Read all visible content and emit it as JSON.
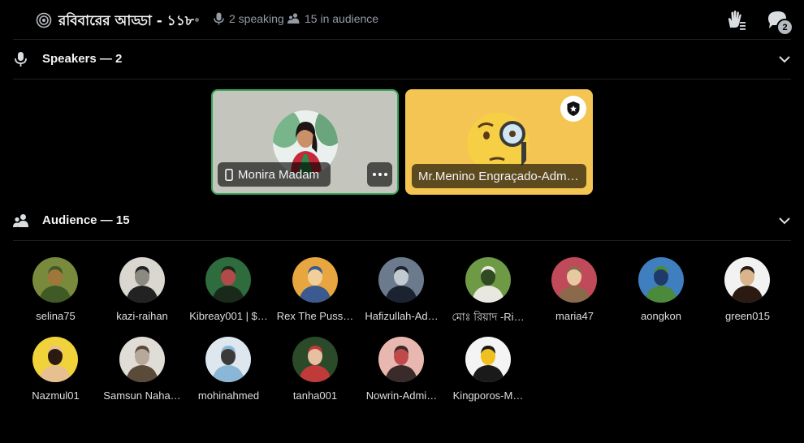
{
  "header": {
    "title": "রবিবারের আড্ডা - ১১৮",
    "speaking": "2 speaking",
    "audience": "15 in audience",
    "chat_badge": "2",
    "icons": [
      "stage-icon",
      "microphone-icon",
      "audience-icon",
      "raise-hand-icon",
      "chat-icon"
    ]
  },
  "speakers_section": {
    "label": "Speakers — 2"
  },
  "speakers": [
    {
      "name": "Monira Madam",
      "device": "mobile-icon",
      "speaking": true,
      "bg": "#c4c6bd"
    },
    {
      "name": "Mr.Menino Engraçado-Adm…",
      "moderator": true,
      "bg": "#f4c552"
    }
  ],
  "audience_section": {
    "label": "Audience — 15"
  },
  "audience": [
    {
      "name": "selina75",
      "colors": [
        "#7a8a3c",
        "#3f5a24",
        "#a0763a"
      ]
    },
    {
      "name": "kazi-raihan",
      "colors": [
        "#d9d7cf",
        "#222222",
        "#8a8a80"
      ]
    },
    {
      "name": "Kibreay001 | $…",
      "colors": [
        "#2e6b3d",
        "#1a2a1a",
        "#b34a4a"
      ]
    },
    {
      "name": "Rex The Puss…",
      "colors": [
        "#e7a640",
        "#3b5a8f",
        "#f0cf9a"
      ]
    },
    {
      "name": "Hafizullah-Ad…",
      "colors": [
        "#6b7a8c",
        "#1b2230",
        "#c1c9d1"
      ]
    },
    {
      "name": "মোঃ রিয়াদ -Ri…",
      "colors": [
        "#6f9a45",
        "#e8e8e0",
        "#2f4a20"
      ]
    },
    {
      "name": "maria47",
      "colors": [
        "#c04a5a",
        "#8a6a4a",
        "#e8c8a0"
      ]
    },
    {
      "name": "aongkon",
      "colors": [
        "#3f7fc0",
        "#4a8a3a",
        "#1e3a6a"
      ]
    },
    {
      "name": "green015",
      "colors": [
        "#f2f2f2",
        "#2a1a12",
        "#d9b48c"
      ]
    },
    {
      "name": "Nazmul01",
      "colors": [
        "#f0d23a",
        "#e8c090",
        "#2a1a10"
      ]
    },
    {
      "name": "Samsun Naha…",
      "colors": [
        "#e0dcd6",
        "#5a4a3a",
        "#b8a89a"
      ]
    },
    {
      "name": "mohinahmed",
      "colors": [
        "#dfe7ee",
        "#8bb7d6",
        "#3a3a3a"
      ]
    },
    {
      "name": "tanha001",
      "colors": [
        "#2a4a2a",
        "#c03a3a",
        "#e6c0a0"
      ]
    },
    {
      "name": "Nowrin-Admi…",
      "colors": [
        "#e8b8b0",
        "#3a2a2a",
        "#c04a4a"
      ]
    },
    {
      "name": "Kingporos-M…",
      "colors": [
        "#f4f4f4",
        "#1a1a1a",
        "#f0c020"
      ]
    }
  ]
}
